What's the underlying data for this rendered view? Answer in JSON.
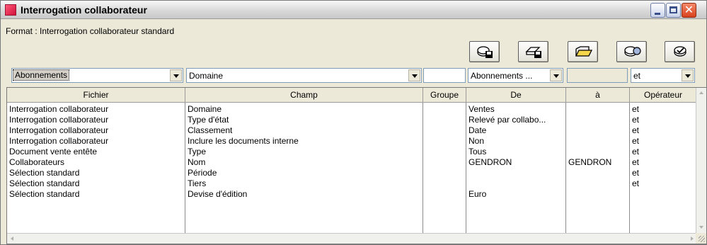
{
  "window": {
    "title": "Interrogation collaborateur",
    "accent": "#e8204a"
  },
  "format": {
    "label": "Format : Interrogation collaborateur standard"
  },
  "toolbar": {
    "buttons": [
      {
        "icon": "save-format-icon"
      },
      {
        "icon": "save-as-format-icon"
      },
      {
        "icon": "open-format-icon"
      },
      {
        "icon": "format-options-icon"
      },
      {
        "icon": "delete-format-icon"
      }
    ]
  },
  "filters": {
    "file_select": "Abonnements",
    "field_select": "Domaine",
    "group_value": "",
    "from_select": "Abonnements ...",
    "to_value": "",
    "operator_select": "et"
  },
  "grid": {
    "columns": [
      "Fichier",
      "Champ",
      "Groupe",
      "De",
      "à",
      "Opérateur"
    ],
    "rows": [
      [
        "Interrogation collaborateur",
        "Domaine",
        "",
        "Ventes",
        "",
        "et"
      ],
      [
        "Interrogation collaborateur",
        "Type d'état",
        "",
        "Relevé par collabo...",
        "",
        "et"
      ],
      [
        "Interrogation collaborateur",
        "Classement",
        "",
        "Date",
        "",
        "et"
      ],
      [
        "Interrogation collaborateur",
        "Inclure les documents interne",
        "",
        "Non",
        "",
        "et"
      ],
      [
        "Document vente entête",
        "Type",
        "",
        "Tous",
        "",
        "et"
      ],
      [
        "Collaborateurs",
        "Nom",
        "",
        "GENDRON",
        "GENDRON",
        "et"
      ],
      [
        "Sélection standard",
        "Période",
        "",
        "",
        "",
        "et"
      ],
      [
        "Sélection standard",
        "Tiers",
        "",
        "",
        "",
        "et"
      ],
      [
        "Sélection standard",
        "Devise d'édition",
        "",
        "Euro",
        "",
        ""
      ]
    ]
  }
}
